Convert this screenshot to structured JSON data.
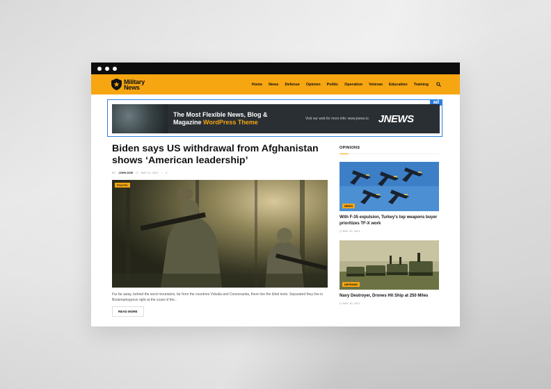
{
  "navbar": {
    "logo_line1": "Military",
    "logo_line2": "News",
    "items": [
      "Home",
      "News",
      "Defense",
      "Opinion",
      "Politic",
      "Operation",
      "Veteran",
      "Education",
      "Training"
    ]
  },
  "ad": {
    "tag": "ad",
    "headline_part1": "The Most Flexible News, Blog & Magazine ",
    "headline_part2": "WordPress Theme",
    "subtext": "Visit our web for more info: www.jnews.io",
    "logo": "JNEWS"
  },
  "article": {
    "title": "Biden says US withdrawal from Afghanistan shows ‘American leadership’",
    "by": "BY",
    "author": "JOHN DOE",
    "date": "MAY 10, 2021",
    "comments": "0",
    "category": "POLITIC",
    "excerpt": "Far far away, behind the word mountains, far from the countries Vokalia and Consonantia, there live the blind texts. Separated they live in Bookmarksgrove right at the coast of the...",
    "read_more": "READ MORE"
  },
  "sidebar": {
    "heading": "OPINIONS",
    "cards": [
      {
        "category": "NEWS",
        "title": "With F-35 expulsion, Turkey’s top weapons buyer prioritizes TF-X work",
        "date": "MAY 10, 2021"
      },
      {
        "category": "DEFENSE",
        "title": "Navy Destroyer, Drones Hit Ship at 250 Miles",
        "date": "MAY 10, 2021"
      }
    ]
  },
  "colors": {
    "accent": "#f6a611",
    "ad_border": "#2a7fdc",
    "titlebar": "#0d0d0d"
  },
  "icons": {
    "logo": "shield-star-icon",
    "search": "search-icon"
  }
}
